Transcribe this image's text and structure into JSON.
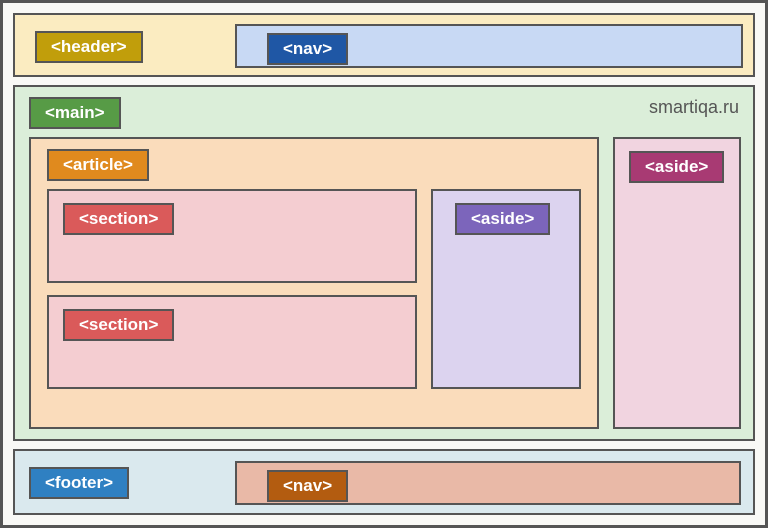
{
  "watermark": "smartiqa.ru",
  "header": {
    "label": "<header>",
    "nav": {
      "label": "<nav>"
    }
  },
  "main": {
    "label": "<main>",
    "article": {
      "label": "<article>",
      "sections": [
        {
          "label": "<section>"
        },
        {
          "label": "<section>"
        }
      ],
      "aside": {
        "label": "<aside>"
      }
    },
    "aside": {
      "label": "<aside>"
    }
  },
  "footer": {
    "label": "<footer>",
    "nav": {
      "label": "<nav>"
    }
  }
}
